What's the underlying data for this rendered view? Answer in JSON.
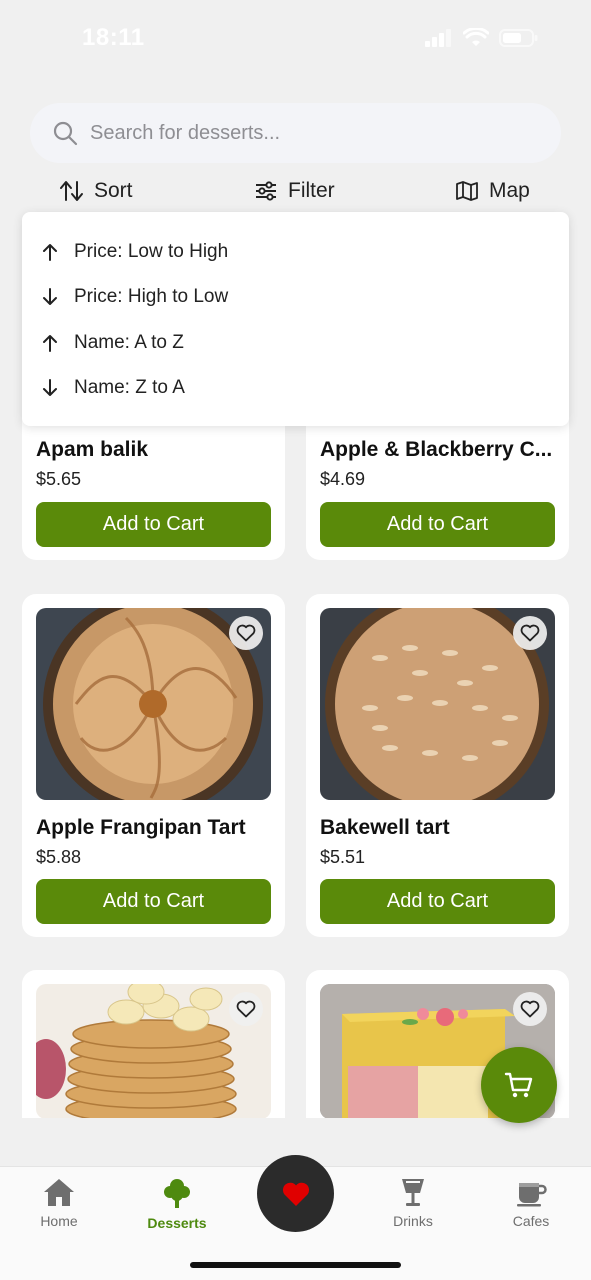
{
  "status": {
    "time": "18:11"
  },
  "search": {
    "placeholder": "Search for desserts..."
  },
  "toolbar": {
    "sort_label": "Sort",
    "filter_label": "Filter",
    "map_label": "Map"
  },
  "sort_menu": {
    "options": [
      {
        "label": "Price: Low to High",
        "icon": "arrow-up-icon"
      },
      {
        "label": "Price: High to Low",
        "icon": "arrow-down-icon"
      },
      {
        "label": "Name: A to Z",
        "icon": "arrow-up-icon"
      },
      {
        "label": "Name: Z to A",
        "icon": "arrow-down-icon"
      }
    ]
  },
  "products": [
    {
      "name": "Apam balik",
      "price": "$5.65",
      "button": "Add to Cart"
    },
    {
      "name": "Apple & Blackberry C...",
      "price": "$4.69",
      "button": "Add to Cart"
    },
    {
      "name": "Apple Frangipan Tart",
      "price": "$5.88",
      "button": "Add to Cart"
    },
    {
      "name": "Bakewell tart",
      "price": "$5.51",
      "button": "Add to Cart"
    },
    {
      "name": "",
      "price": "",
      "button": ""
    },
    {
      "name": "",
      "price": "",
      "button": ""
    }
  ],
  "nav": {
    "items": [
      {
        "label": "Home",
        "icon": "home-icon",
        "active": false
      },
      {
        "label": "Desserts",
        "icon": "tree-icon",
        "active": true
      },
      {
        "label": "",
        "icon": "heart-icon",
        "active": false
      },
      {
        "label": "Drinks",
        "icon": "glass-icon",
        "active": false
      },
      {
        "label": "Cafes",
        "icon": "coffee-cup-icon",
        "active": false
      }
    ]
  },
  "colors": {
    "accent": "#5a8a0a",
    "nav_active": "#4e8a0f",
    "heart": "#e00000",
    "fab_dark": "#2b2b2b"
  }
}
